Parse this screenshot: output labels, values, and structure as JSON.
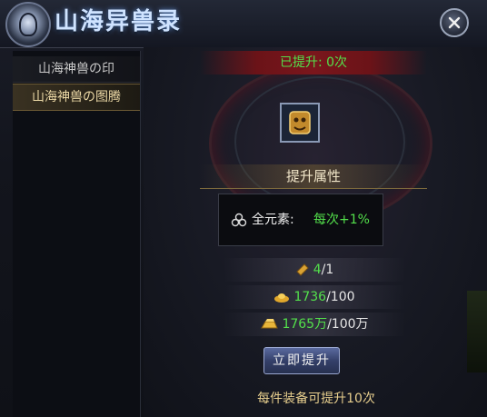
{
  "window": {
    "title": "山海异兽录"
  },
  "sidebar": {
    "items": [
      {
        "label": "山海神兽の印",
        "selected": false
      },
      {
        "label": "山海神兽の图腾",
        "selected": true
      }
    ]
  },
  "main": {
    "upgrade_status": "已提升: 0次",
    "attr_title": "提升属性",
    "attribute": {
      "label": "全元素:",
      "value": "每次+1%"
    },
    "costs": [
      {
        "icon": "scroll-icon",
        "have": "4",
        "need": "/1"
      },
      {
        "icon": "gold-ingot-icon",
        "have": "1736",
        "need": "/100"
      },
      {
        "icon": "gold-bar-icon",
        "have": "1765万",
        "need": "/100万"
      }
    ],
    "upgrade_button": "立即提升",
    "footer_note": "每件装备可提升10次"
  },
  "colors": {
    "green": "#53e04b",
    "gold": "#e8cf8e",
    "accent_red": "#6b1318"
  }
}
